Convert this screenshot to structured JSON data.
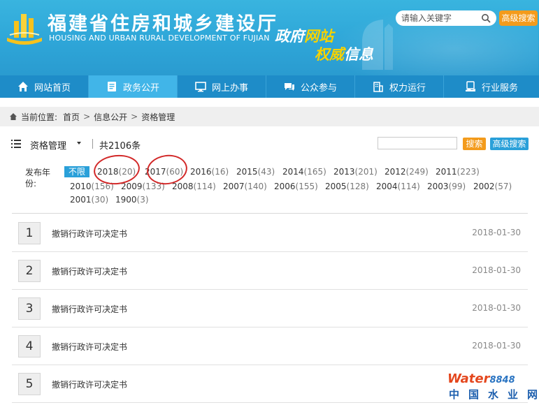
{
  "header": {
    "title": "福建省住房和城乡建设厅",
    "subtitle": "HOUSING AND URBAN RURAL DEVELOPMENT OF FUJIAN",
    "slogan_line1_a": "政府",
    "slogan_line1_b": "网站",
    "slogan_line2_a": "权威",
    "slogan_line2_b": "信息",
    "search_placeholder": "请输入关键字",
    "advanced_search": "高级搜索"
  },
  "nav": {
    "items": [
      {
        "label": "网站首页",
        "icon": "home-icon"
      },
      {
        "label": "政务公开",
        "icon": "document-icon",
        "active": true
      },
      {
        "label": "网上办事",
        "icon": "monitor-icon"
      },
      {
        "label": "公众参与",
        "icon": "chat-icon"
      },
      {
        "label": "权力运行",
        "icon": "building-icon"
      },
      {
        "label": "行业服务",
        "icon": "service-icon"
      }
    ]
  },
  "breadcrumb": {
    "prefix": "当前位置:",
    "items": [
      "首页",
      "信息公开",
      "资格管理"
    ],
    "separator": ">"
  },
  "toolbar": {
    "category": "资格管理",
    "count": "共2106条",
    "search_label": "搜索",
    "advanced_label": "高级搜索"
  },
  "year_filter": {
    "label": "发布年份:",
    "all_label": "不限",
    "years": [
      {
        "year": "2018",
        "count": "(20)"
      },
      {
        "year": "2017",
        "count": "(60)"
      },
      {
        "year": "2016",
        "count": "(16)"
      },
      {
        "year": "2015",
        "count": "(43)"
      },
      {
        "year": "2014",
        "count": "(165)"
      },
      {
        "year": "2013",
        "count": "(201)"
      },
      {
        "year": "2012",
        "count": "(249)"
      },
      {
        "year": "2011",
        "count": "(223)"
      },
      {
        "year": "2010",
        "count": "(156)"
      },
      {
        "year": "2009",
        "count": "(133)"
      },
      {
        "year": "2008",
        "count": "(114)"
      },
      {
        "year": "2007",
        "count": "(140)"
      },
      {
        "year": "2006",
        "count": "(155)"
      },
      {
        "year": "2005",
        "count": "(128)"
      },
      {
        "year": "2004",
        "count": "(114)"
      },
      {
        "year": "2003",
        "count": "(99)"
      },
      {
        "year": "2002",
        "count": "(57)"
      },
      {
        "year": "2001",
        "count": "(30)"
      },
      {
        "year": "1900",
        "count": "(3)"
      }
    ]
  },
  "list": {
    "rows": [
      {
        "num": "1",
        "title": "撤销行政许可决定书",
        "date": "2018-01-30"
      },
      {
        "num": "2",
        "title": "撤销行政许可决定书",
        "date": "2018-01-30"
      },
      {
        "num": "3",
        "title": "撤销行政许可决定书",
        "date": "2018-01-30"
      },
      {
        "num": "4",
        "title": "撤销行政许可决定书",
        "date": "2018-01-30"
      },
      {
        "num": "5",
        "title": "撤销行政许可决定书",
        "date": ""
      }
    ]
  },
  "watermark": {
    "line1_a": "Water",
    "line1_b": "8848",
    "line2": "中国水业网"
  },
  "colors": {
    "banner": "#2ea6d8",
    "nav": "#1e8cc8",
    "nav_active": "#41b5e8",
    "orange_button": "#f39b1c",
    "blue_button": "#2aa0d9",
    "annotation_circle": "#d22828"
  }
}
